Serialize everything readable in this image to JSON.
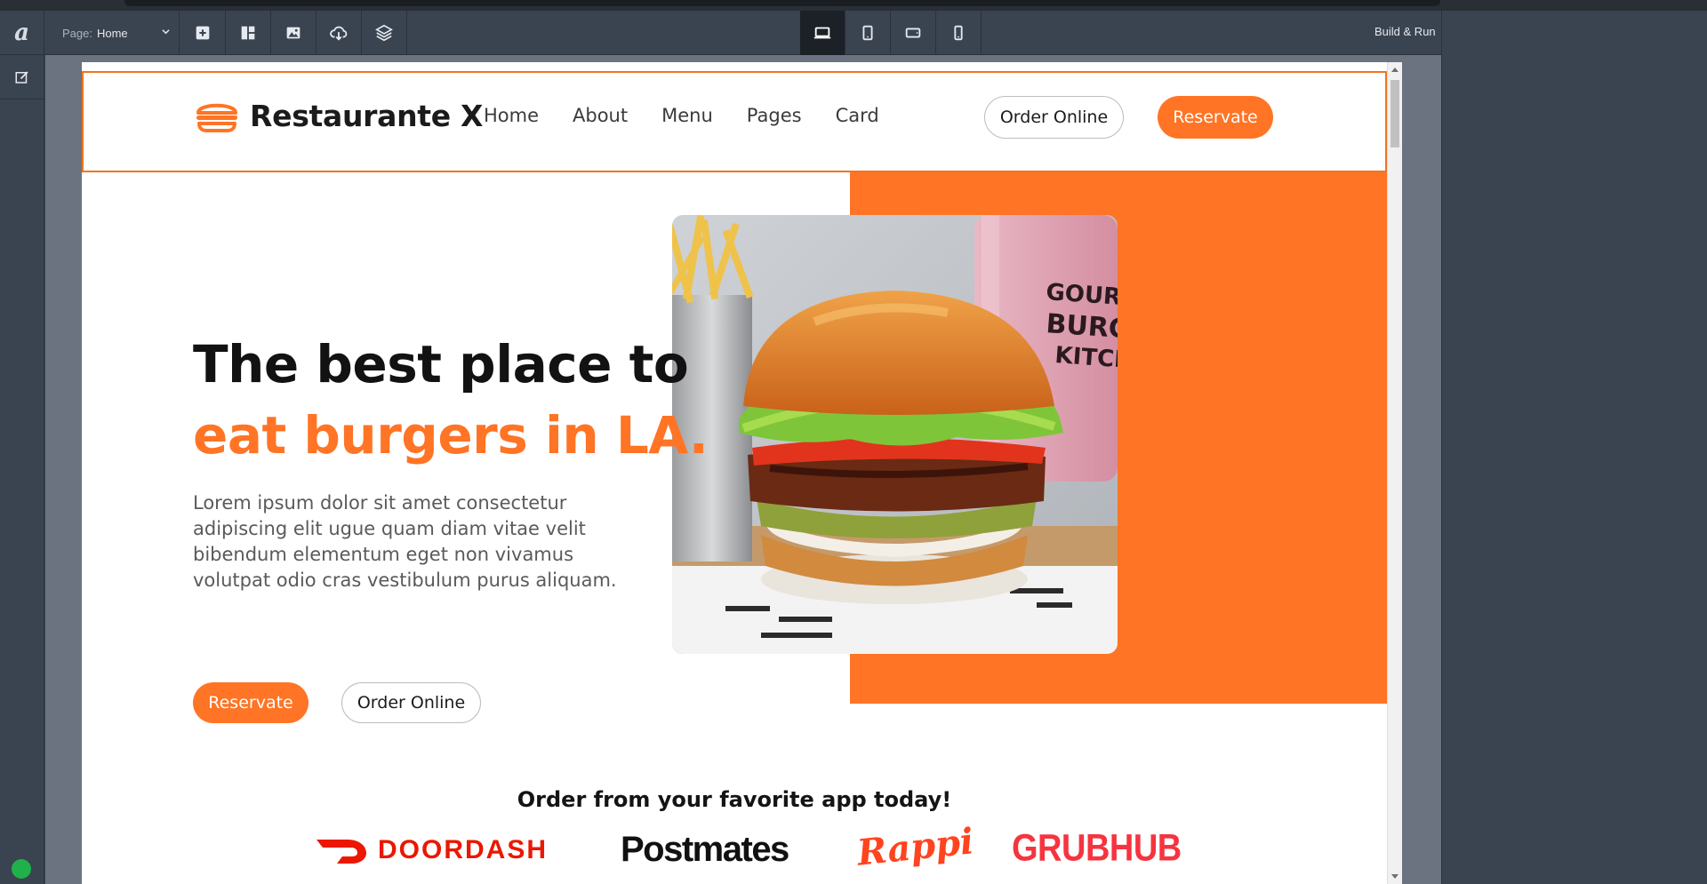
{
  "toolbar": {
    "logo": "a",
    "page_label": "Page:",
    "page_value": "Home",
    "build_label": "Build & Run",
    "tools": [
      "add-icon",
      "layout-icon",
      "image-icon",
      "cloud-download-icon",
      "layers-icon"
    ],
    "devices": [
      "desktop-icon",
      "tablet-icon",
      "tablet-landscape-icon",
      "mobile-icon"
    ],
    "active_device": "desktop-icon"
  },
  "sidebar": {
    "items": [
      "edit-icon"
    ],
    "status_color": "#20b14a"
  },
  "site": {
    "brand": "Restaurante X",
    "nav": [
      "Home",
      "About",
      "Menu",
      "Pages",
      "Card"
    ],
    "header_order": "Order Online",
    "header_reservate": "Reservate",
    "hero_line1": "The best place to",
    "hero_line2": "eat burgers in LA.",
    "hero_text": "Lorem ipsum dolor sit amet consectetur adipiscing elit ugue quam diam vitae velit bibendum elementum eget non vivamus volutpat odio cras vestibulum purus aliquam.",
    "hero_reservate": "Reservate",
    "hero_order": "Order Online",
    "image_sign": "GOURMET BURGER KITCHEN",
    "order_title": "Order from your favorite app today!",
    "apps": [
      "DOORDASH",
      "Postmates",
      "Rappi",
      "GRUBHUB"
    ],
    "accent": "#ff7425"
  }
}
